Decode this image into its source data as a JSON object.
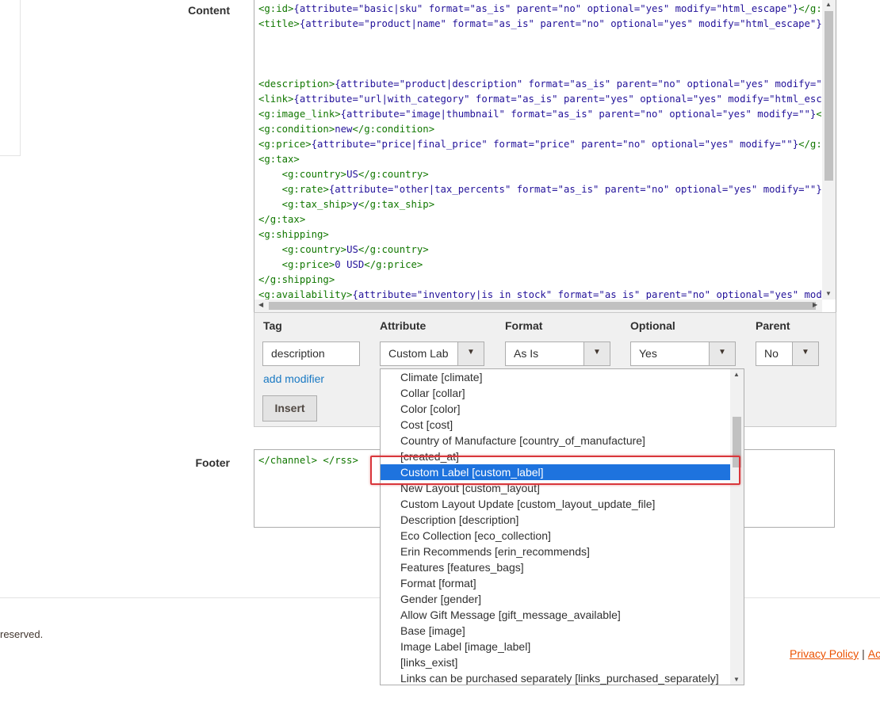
{
  "labels": {
    "content": "Content",
    "footer": "Footer"
  },
  "editor": {
    "lines": [
      "<g:id>{attribute=\"basic|sku\" format=\"as_is\" parent=\"no\" optional=\"yes\" modify=\"html_escape\"}</g:id>",
      "<title>{attribute=\"product|name\" format=\"as_is\" parent=\"no\" optional=\"yes\" modify=\"html_escape\"}</title>",
      "",
      "",
      "",
      "<description>{attribute=\"product|description\" format=\"as_is\" parent=\"no\" optional=\"yes\" modify=\"\"}</description>",
      "<link>{attribute=\"url|with_category\" format=\"as_is\" parent=\"yes\" optional=\"yes\" modify=\"html_escape\"}</link>",
      "<g:image_link>{attribute=\"image|thumbnail\" format=\"as_is\" parent=\"no\" optional=\"yes\" modify=\"\"}</g:image_link>",
      "<g:condition>new</g:condition>",
      "<g:price>{attribute=\"price|final_price\" format=\"price\" parent=\"no\" optional=\"yes\" modify=\"\"}</g:price>",
      "<g:tax>",
      "    <g:country>US</g:country>",
      "    <g:rate>{attribute=\"other|tax_percents\" format=\"as_is\" parent=\"no\" optional=\"yes\" modify=\"\"}</g:rate>",
      "    <g:tax_ship>y</g:tax_ship>",
      "</g:tax>",
      "<g:shipping>",
      "    <g:country>US</g:country>",
      "    <g:price>0 USD</g:price>",
      "</g:shipping>",
      "<g:availability>{attribute=\"inventory|is_in_stock\" format=\"as_is\" parent=\"no\" optional=\"yes\" modify=\"\"}</g:availability>"
    ]
  },
  "toolbar": {
    "headers": {
      "tag": "Tag",
      "attribute": "Attribute",
      "format": "Format",
      "optional": "Optional",
      "parent": "Parent"
    },
    "tag_value": "description",
    "attribute_value": "Custom Lab",
    "format_value": "As Is",
    "optional_value": "Yes",
    "parent_value": "No",
    "add_modifier": "add modifier",
    "insert": "Insert"
  },
  "footer_code": "</channel> </rss>",
  "page_footer": {
    "reserved": "reserved.",
    "privacy": "Privacy Policy",
    "separator": "|",
    "next_link": "Ac"
  },
  "dropdown": {
    "selected_index": 6,
    "options": [
      "Climate [climate]",
      "Collar [collar]",
      "Color [color]",
      "Cost [cost]",
      "Country of Manufacture [country_of_manufacture]",
      "[created_at]",
      "Custom Label [custom_label]",
      "New Layout [custom_layout]",
      "Custom Layout Update [custom_layout_update_file]",
      "Description [description]",
      "Eco Collection [eco_collection]",
      "Erin Recommends [erin_recommends]",
      "Features [features_bags]",
      "Format [format]",
      "Gender [gender]",
      "Allow Gift Message [gift_message_available]",
      "Base [image]",
      "Image Label [image_label]",
      "[links_exist]",
      "Links can be purchased separately [links_purchased_separately]"
    ]
  },
  "colors": {
    "code_tag": "#117700",
    "code_text": "#221199",
    "selection": "#1e73de",
    "highlight_border": "#d9363b",
    "link": "#1979c3",
    "footer_link": "#eb5202"
  }
}
